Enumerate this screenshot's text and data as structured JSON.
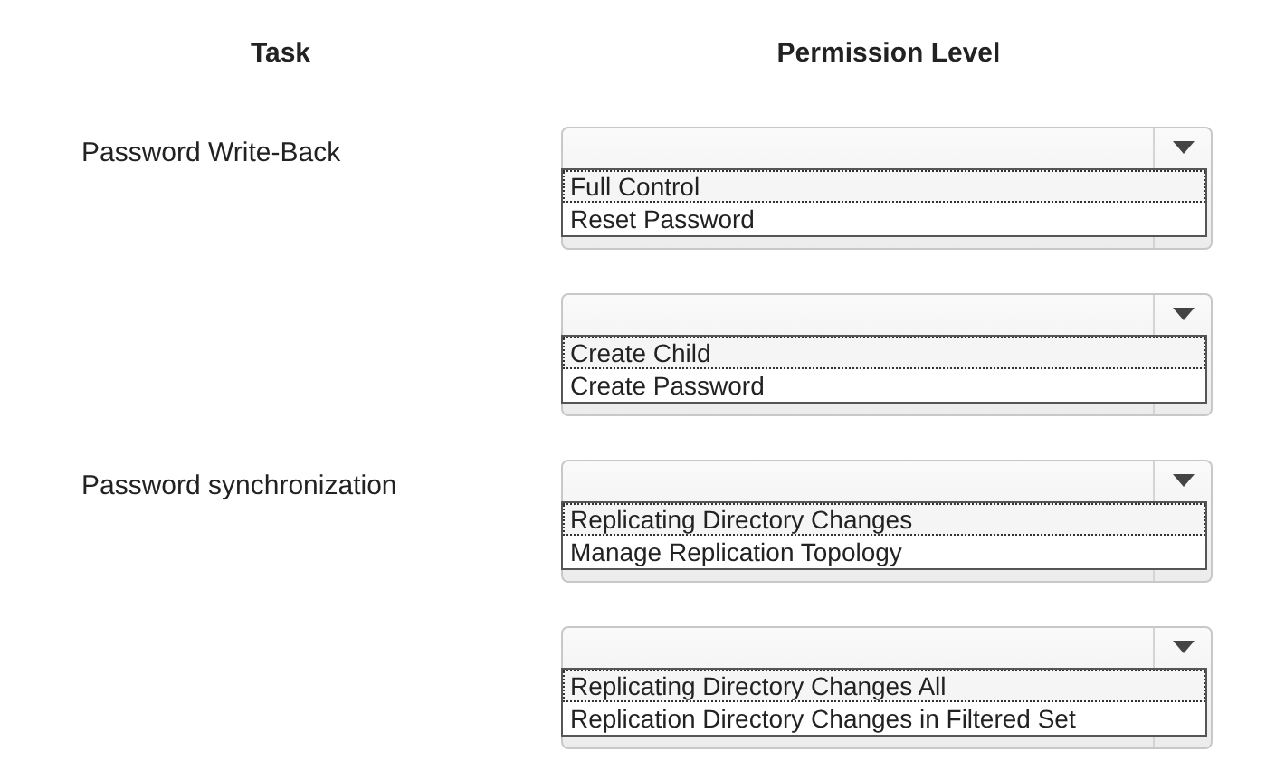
{
  "headers": {
    "task": "Task",
    "permission": "Permission Level"
  },
  "rows": [
    {
      "task": "Password Write-Back",
      "options": [
        {
          "label": "Full Control",
          "focused": true
        },
        {
          "label": "Reset Password",
          "focused": false
        }
      ]
    },
    {
      "options": [
        {
          "label": "Create Child",
          "focused": true
        },
        {
          "label": "Create Password",
          "focused": false
        }
      ]
    },
    {
      "task": "Password synchronization",
      "options": [
        {
          "label": "Replicating Directory Changes",
          "focused": true
        },
        {
          "label": "Manage Replication Topology",
          "focused": false
        }
      ]
    },
    {
      "options": [
        {
          "label": "Replicating Directory Changes All",
          "focused": true
        },
        {
          "label": "Replication Directory Changes in Filtered Set",
          "focused": false
        }
      ]
    }
  ]
}
